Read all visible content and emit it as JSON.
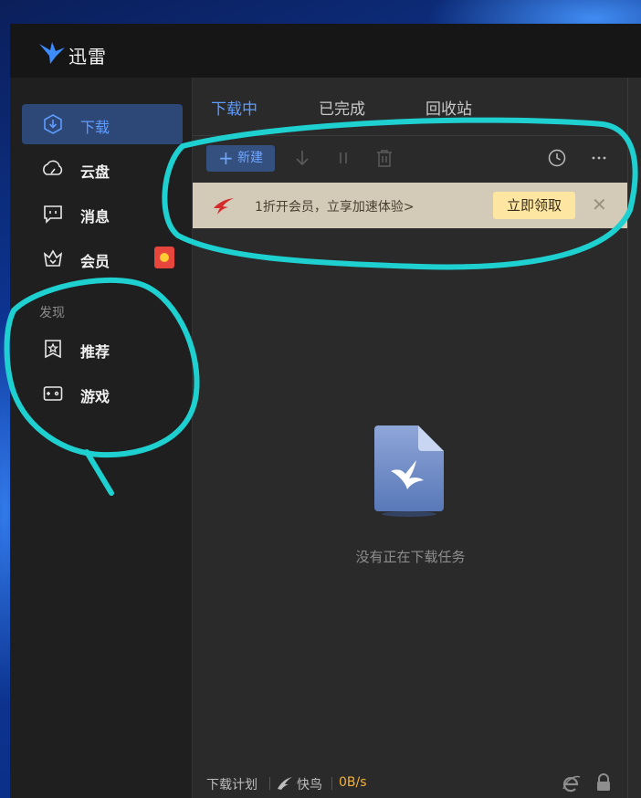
{
  "app": {
    "title": "迅雷"
  },
  "sidebar": {
    "items": [
      {
        "label": "下载",
        "icon": "download-icon",
        "active": true
      },
      {
        "label": "云盘",
        "icon": "cloud-icon"
      },
      {
        "label": "消息",
        "icon": "message-icon"
      },
      {
        "label": "会员",
        "icon": "crown-icon",
        "badge_icon": "red-packet-icon"
      }
    ],
    "discover_label": "发现",
    "discover_items": [
      {
        "label": "推荐",
        "icon": "star-icon"
      },
      {
        "label": "游戏",
        "icon": "gamepad-icon"
      }
    ]
  },
  "tabs": [
    {
      "label": "下载中",
      "active": true
    },
    {
      "label": "已完成"
    },
    {
      "label": "回收站"
    }
  ],
  "toolbar": {
    "new_label": "新建",
    "icons": [
      "download-arrow-icon",
      "pause-icon",
      "trash-icon",
      "history-clock-icon",
      "more-icon"
    ]
  },
  "promo": {
    "text": "1折开会员，立享加速体验>",
    "claim_label": "立即领取",
    "close": "✕"
  },
  "empty_state": {
    "message": "没有正在下载任务"
  },
  "statusbar": {
    "plan_label": "下载计划",
    "bird_label": "快鸟",
    "speed": "0B/s"
  },
  "colors": {
    "accent": "#5f9cff",
    "active_nav_bg": "#2d4777",
    "promo_bg": "#d3cab8",
    "claim_bg": "#fde5a2",
    "speed": "#f5b233",
    "annotation": "#1ed0d0"
  }
}
